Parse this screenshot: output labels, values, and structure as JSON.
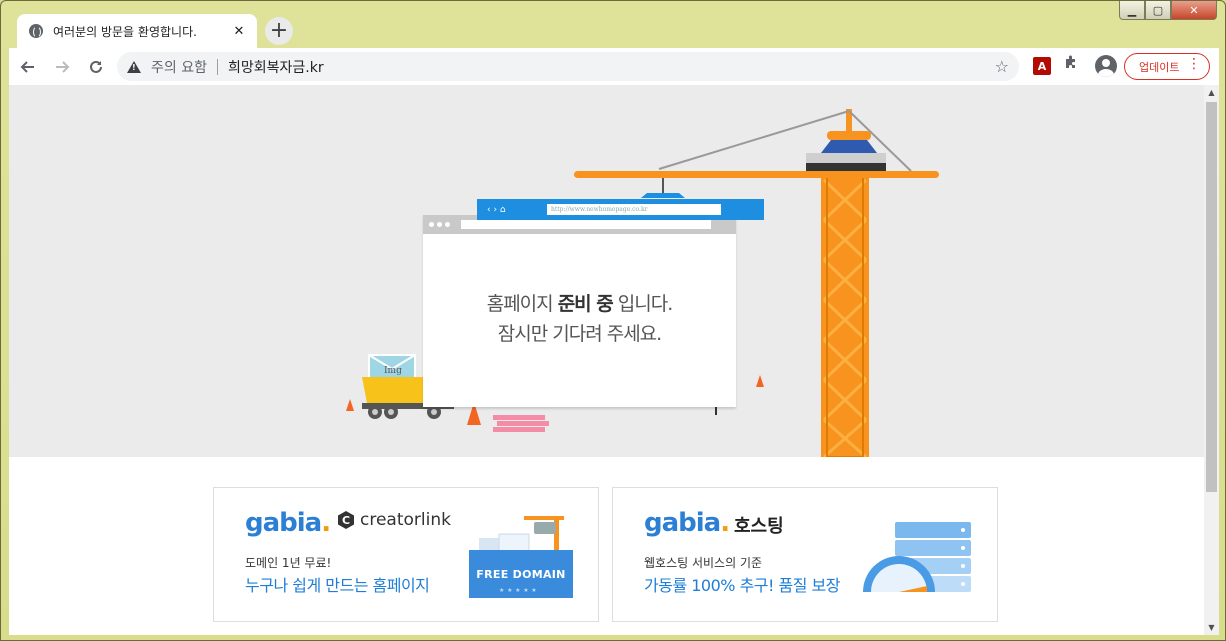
{
  "browser": {
    "tab_title": "여러분의 방문을 환영합니다.",
    "tab_close": "✕",
    "new_tab": "+",
    "security_label": "주의 요함",
    "url": "희망회복자금.kr",
    "update_label": "업데이트",
    "pdf_ext_label": "A"
  },
  "illustration": {
    "mock_url": "http://www.newhomepage.co.kr",
    "message_line1_pre": "홈페이지 ",
    "message_line1_strong": "준비 중",
    "message_line1_post": " 입니다.",
    "message_line2": "잠시만 기다려 주세요.",
    "img_label": "Img"
  },
  "ads": {
    "left": {
      "brand": "gabia",
      "partner": "creatorlink",
      "partner_icon_letter": "C",
      "small_text": "도메인 1년 무료!",
      "big_text": "누구나 쉽게 만드는 홈페이지",
      "badge": "FREE DOMAIN"
    },
    "right": {
      "brand": "gabia",
      "title": "호스팅",
      "small_text": "웹호스팅 서비스의 기준",
      "big_text": "가동률 100% 추구! 품질 보장"
    }
  },
  "colors": {
    "accent_blue": "#1e8fe0",
    "crane_orange": "#f7931e",
    "update_red": "#d93025"
  }
}
